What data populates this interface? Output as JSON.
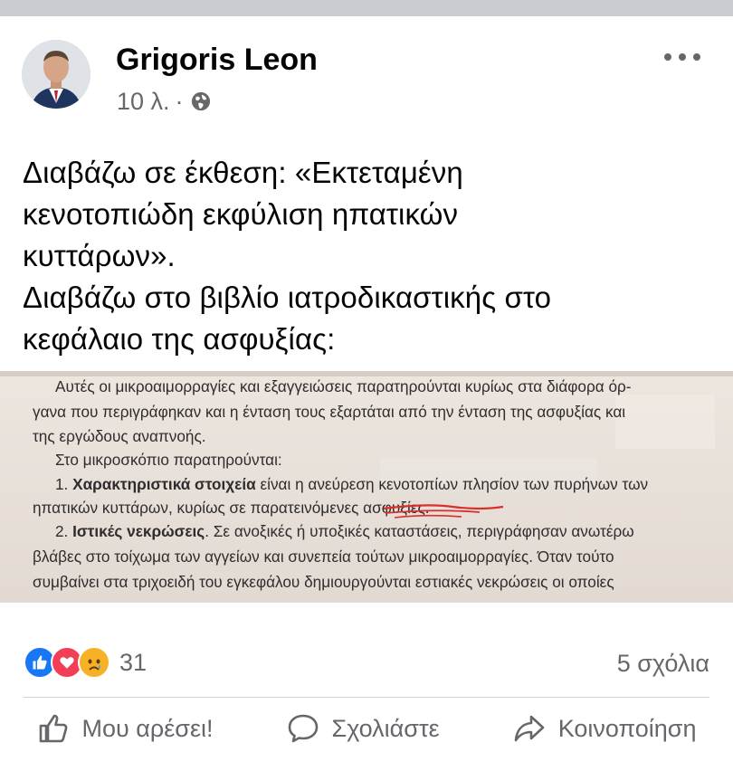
{
  "post": {
    "author": "Grigoris Leon",
    "time": "10 λ.",
    "separator": "·",
    "privacy_icon": "globe-icon",
    "text_lines": [
      "Διαβάζω σε έκθεση: «Εκτεταμένη",
      "κενοτοπιώδη εκφύλιση ηπατικών",
      "κυττάρων».",
      "Διαβάζω στο βιβλίο ιατροδικαστικής στο",
      "κεφάλαιο της ασφυξίας:"
    ]
  },
  "photo": {
    "line1": "Αυτές οι μικροαιμορραγίες και εξαγγειώσεις παρατηρούνται κυρίως στα διάφορα όρ-",
    "line2": "γανα που περιγράφηκαν και η ένταση τους εξαρτάται από την ένταση της ασφυξίας και",
    "line3": "της εργώδους αναπνοής.",
    "line4": "Στο μικροσκόπιο παρατηρούνται:",
    "line5_num": "1. ",
    "line5_bold": "Χαρακτηριστικά στοιχεία",
    "line5_rest": " είναι η ανεύρεση κενοτοπίων πλησίον των πυρήνων των",
    "line6": "ηπατικών κυττάρων, κυρίως σε παρατεινόμενες ασφυξίες.",
    "line7_num": "2. ",
    "line7_bold": "Ιστικές νεκρώσεις",
    "line7_rest": ". Σε ανοξικές ή υποξικές καταστάσεις, περιγράφησαν ανωτέρω",
    "line8": "βλάβες στο τοίχωμα των αγγείων και συνεπεία τούτων μικροαιμορραγίες. Όταν τούτο",
    "line9": "συμβαίνει στα τριχοειδή του εγκεφάλου δημιουργούνται εστιακές νεκρώσεις οι οποίες"
  },
  "reactions": {
    "icons": [
      "like-icon",
      "love-icon",
      "sad-icon"
    ],
    "count": "31",
    "comments": "5 σχόλια"
  },
  "actions": {
    "like": "Μου αρέσει!",
    "comment": "Σχολιάστε",
    "share": "Κοινοποίηση"
  },
  "colors": {
    "like_blue": "#1877f2",
    "love_red": "#f33e58",
    "sad_yellow": "#f7b125",
    "secondary_text": "#65676b",
    "highlight_red": "#e8291c"
  }
}
